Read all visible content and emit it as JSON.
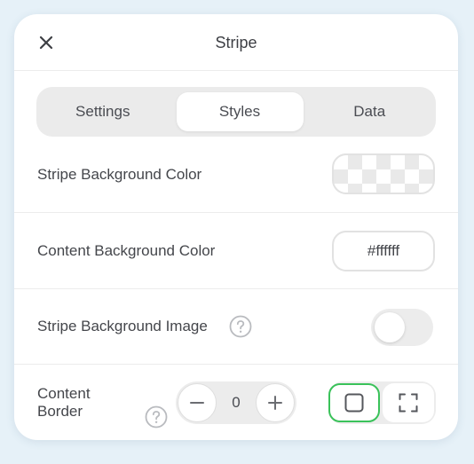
{
  "dialog": {
    "title": "Stripe"
  },
  "tabs": [
    {
      "label": "Settings",
      "active": false
    },
    {
      "label": "Styles",
      "active": true
    },
    {
      "label": "Data",
      "active": false
    }
  ],
  "fields": {
    "stripe_bg_color": {
      "label": "Stripe Background Color",
      "value": "transparent"
    },
    "content_bg_color": {
      "label": "Content Background Color",
      "value": "#ffffff"
    },
    "stripe_bg_image": {
      "label": "Stripe Background Image",
      "enabled": false
    },
    "content_border": {
      "label_line1": "Content",
      "label_line2": "Border",
      "value": "0",
      "style_options": [
        "solid",
        "dashed"
      ],
      "selected_style": "solid"
    }
  },
  "icons": {
    "close": "close-icon",
    "help": "help-icon",
    "minus": "minus-icon",
    "plus": "plus-icon",
    "border_solid": "border-solid-icon",
    "border_corners": "border-corners-icon"
  },
  "colors": {
    "background": "#e6f1f8",
    "panel": "#ffffff",
    "selected_outline": "#3ac25a",
    "control_track": "#ececec"
  }
}
